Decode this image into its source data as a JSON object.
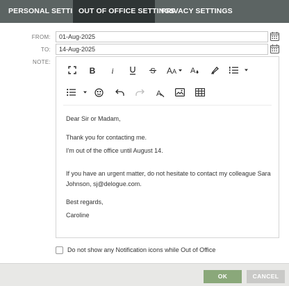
{
  "tabs": [
    {
      "label": "PERSONAL SETTINGS"
    },
    {
      "label": "OUT OF OFFICE SETTINGS",
      "active": true
    },
    {
      "label": "PRIVACY SETTINGS"
    }
  ],
  "form": {
    "from_label": "FROM:",
    "from_value": "01-Aug-2025",
    "to_label": "TO:",
    "to_value": "14-Aug-2025",
    "note_label": "NOTE:"
  },
  "toolbar": {
    "row1": [
      "fullscreen-icon",
      "bold-icon",
      "italic-icon",
      "underline-icon",
      "strikethrough-icon",
      "font-size-icon",
      "text-color-icon",
      "highlight-icon",
      "ordered-list-icon"
    ],
    "row2": [
      "bullet-list-icon",
      "emoji-icon",
      "undo-icon",
      "redo-icon",
      "clear-format-icon",
      "image-icon",
      "table-icon"
    ],
    "font_size_glyph": "AA"
  },
  "message": {
    "greeting": "Dear Sir or Madam,",
    "thanks": "Thank you for contacting me.",
    "away": "I'm out of the office until August 14.",
    "urgent": "If you have an urgent matter, do not hesitate to contact my colleague Sara Johnson, sj@delogue.com.",
    "closing": "Best regards,",
    "signature": "Caroline"
  },
  "checkbox": {
    "label": "Do not show any Notification icons while Out of Office",
    "checked": false
  },
  "buttons": {
    "ok": "OK",
    "cancel": "CANCEL"
  },
  "colors": {
    "tabbar": "#5c6463",
    "tab_active": "#2f3535",
    "ok": "#8aa87a",
    "cancel": "#c9c9c7"
  }
}
